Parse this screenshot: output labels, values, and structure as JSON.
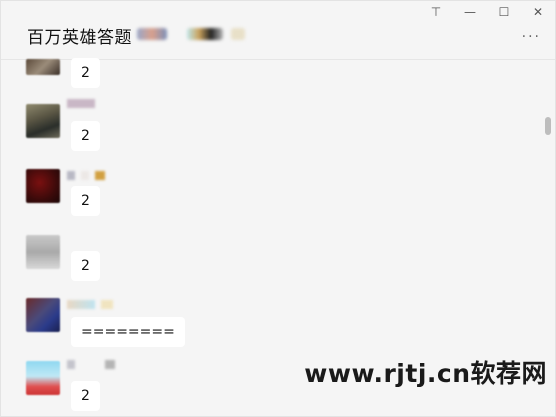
{
  "window": {
    "title": "百万英雄答题",
    "controls": {
      "pin_icon": "⊤",
      "minimize_icon": "—",
      "maximize_icon": "☐",
      "close_icon": "✕"
    },
    "more_label": "···"
  },
  "messages": [
    {
      "text": "2"
    },
    {
      "text": "2"
    },
    {
      "text": "2"
    },
    {
      "text": "2"
    },
    {
      "text": "========"
    },
    {
      "text": "2"
    }
  ],
  "watermark": "www.rjtj.cn软荐网"
}
